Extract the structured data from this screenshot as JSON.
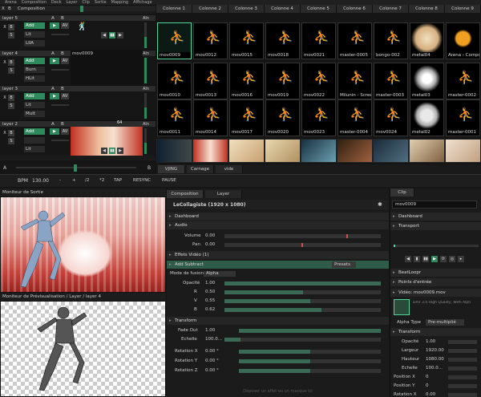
{
  "menu": [
    "Arena",
    "Composition",
    "Deck",
    "Layer",
    "Clip",
    "Sortie",
    "Mapping",
    "Affichage"
  ],
  "layers": [
    {
      "name": "layer 5",
      "clip": "",
      "modes": [
        "Add",
        "Lit",
        "LIIA"
      ]
    },
    {
      "name": "layer 4",
      "clip": "mov0009",
      "modes": [
        "Add",
        "Burn",
        "HLit"
      ]
    },
    {
      "name": "layer 3",
      "clip": "",
      "modes": [
        "Add",
        "Lit",
        "Mult"
      ]
    },
    {
      "name": "layer 2",
      "clip": "",
      "modes": [
        "Add",
        "",
        "Lit"
      ]
    }
  ],
  "composition_label": "Composition",
  "bpm_label": "BPM",
  "bpm_value": "130.00",
  "bpm_buttons": [
    "-",
    "+",
    "/2",
    "*2",
    "TAP",
    "RESYNC",
    "PAUSE"
  ],
  "clip_counter": "64",
  "col_headers": [
    "Colonne 1",
    "Colonne 2",
    "Colonne 3",
    "Colonne 4",
    "Colonne 5",
    "Colonne 6",
    "Colonne 7",
    "Colonne 8",
    "Colonne 9"
  ],
  "clip_rows": [
    [
      "mov0009",
      "mov0012",
      "mov0015",
      "mov0018",
      "mov0021",
      "master-0005",
      "bongo-002",
      "metal04",
      "Arena - Composit..."
    ],
    [
      "mov0010",
      "mov0013",
      "mov0016",
      "mov0019",
      "mov0022",
      "Milunin - Screen...",
      "master-0003",
      "metal03",
      "master-0002"
    ],
    [
      "mov0011",
      "mov0014",
      "mov0017",
      "mov0020",
      "mov0023",
      "master-0004",
      "mov0024",
      "metal02",
      "master-0001"
    ]
  ],
  "deck_tabs": [
    "VJING",
    "Carnage",
    "vide"
  ],
  "output_monitor": "Moniteur de Sortie",
  "preview_monitor": "Moniteur de Prévisualisation / Layer / layer 4",
  "comp_tabs": [
    "Composition",
    "Layer"
  ],
  "layer_name": "LeCollagiste (1920 x 1080)",
  "sections": {
    "dashboard": "Dashboard",
    "audio": "Audio",
    "effects": "Effets Vidéo (1)",
    "subtract": "Add Subtract",
    "transform": "Transform"
  },
  "audio": {
    "volume_label": "Volume",
    "volume": "0.00",
    "pan_label": "Pan",
    "pan": "0.00"
  },
  "presets_label": "Presets",
  "blend": {
    "label": "Mode de fusion",
    "value": "Alpha"
  },
  "subtract_props": [
    {
      "label": "Opacité",
      "value": "1.00",
      "pct": 1.0
    },
    {
      "label": "R",
      "value": "0.50",
      "pct": 0.5
    },
    {
      "label": "V",
      "value": "0.55",
      "pct": 0.55
    },
    {
      "label": "B",
      "value": "0.62",
      "pct": 0.62
    }
  ],
  "transform_props": [
    {
      "label": "Fade Out",
      "value": "1.00",
      "pct": 1.0
    },
    {
      "label": "Echelle",
      "value": "100.0...",
      "pct": 0.1
    },
    {
      "label": "Rotation X",
      "value": "0.00 °",
      "pct": 0.5
    },
    {
      "label": "Rotation Y",
      "value": "0.00 °",
      "pct": 0.5
    },
    {
      "label": "Rotation Z",
      "value": "0.00 °",
      "pct": 0.5
    }
  ],
  "clip_panel": {
    "tab": "Clip",
    "name": "mov0009",
    "dashboard": "Dashboard",
    "transport": "Transport",
    "beatloop": "BeatLoopr",
    "entry_points": "Points d'entrée",
    "video": "Vidéo: mov0009.mov",
    "video_info": "DXV 3.0 High Quality, With Alph",
    "alpha_type_label": "Alpha Type",
    "alpha_type": "Pre-multiplié",
    "transform": "Transform",
    "props": [
      {
        "label": "Opacité",
        "value": "1.00"
      },
      {
        "label": "Largeur",
        "value": "1920.00"
      },
      {
        "label": "Hauteur",
        "value": "1080.00"
      },
      {
        "label": "Echelle",
        "value": "100.0..."
      },
      {
        "label": "Position X",
        "value": "0"
      },
      {
        "label": "Position Y",
        "value": "0"
      },
      {
        "label": "Rotation X",
        "value": "0.00"
      }
    ]
  },
  "drop_hint": "Déposer un effet ou un masque ici",
  "colors": {
    "accent": "#2e8a5c",
    "select": "#4fd6a0"
  }
}
